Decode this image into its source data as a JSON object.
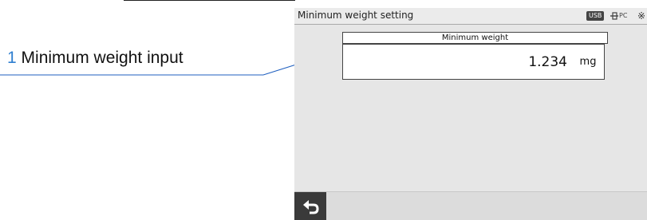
{
  "callout": {
    "number": "1",
    "label": "Minimum weight input"
  },
  "screen": {
    "title": "Minimum weight setting",
    "status": {
      "usb_badge": "USB",
      "pc_label": "PC",
      "icons": [
        "usb-badge-icon",
        "pc-connection-icon",
        "bluetooth-icon"
      ]
    },
    "field": {
      "label": "Minimum weight",
      "value": "1.234",
      "unit": "mg"
    },
    "footer": {
      "back_icon": "return-arrow-icon"
    }
  },
  "colors": {
    "callout_number": "#2f7fd0",
    "leader_line": "#1f5fbf",
    "screen_background": "#e6e6e6",
    "back_button": "#3a3a3a"
  }
}
